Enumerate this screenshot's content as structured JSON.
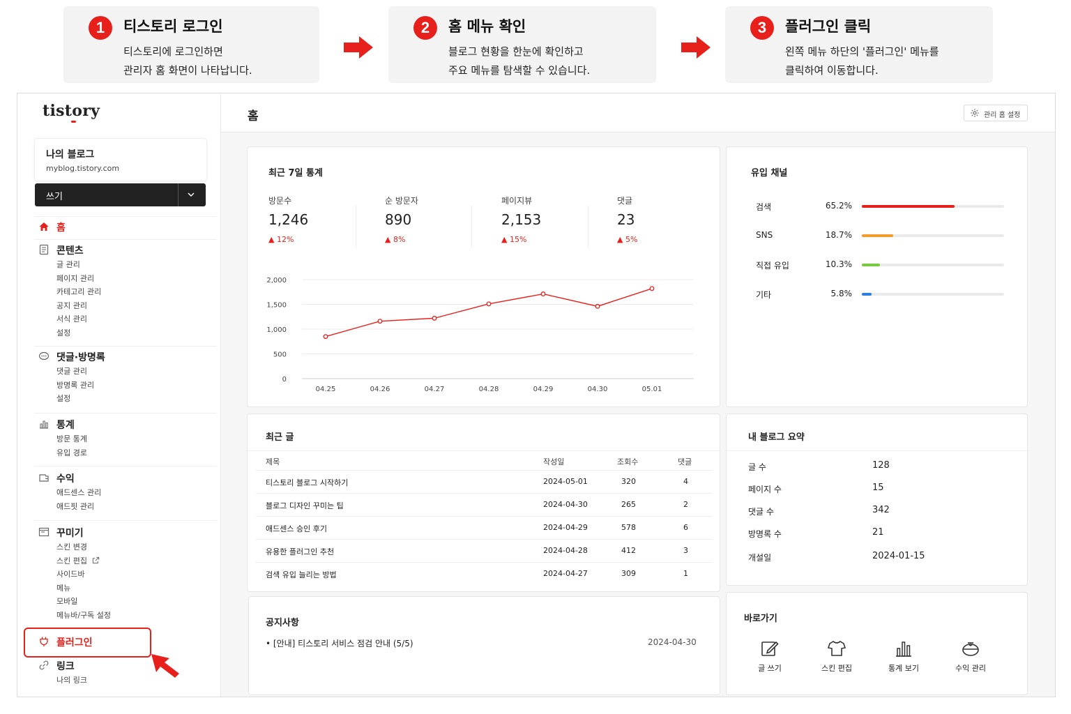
{
  "steps": [
    {
      "number": "1",
      "title": "티스토리 로그인",
      "desc1": "티스토리에 로그인하면",
      "desc2": "관리자 홈 화면이 나타납니다."
    },
    {
      "number": "2",
      "title": "홈 메뉴 확인",
      "desc1": "블로그 현황을 한눈에 확인하고",
      "desc2": "주요 메뉴를 탐색할 수 있습니다."
    },
    {
      "number": "3",
      "title": "플러그인 클릭",
      "desc1": "왼쪽 메뉴 하단의 '플러그인' 메뉴를",
      "desc2": "클릭하여 이동합니다."
    }
  ],
  "brand": "tistory",
  "blog": {
    "name": "나의 블로그",
    "url": "myblog.tistory.com"
  },
  "write_label": "쓰기",
  "nav": {
    "home": "홈",
    "content": {
      "label": "콘텐츠",
      "items": [
        "글 관리",
        "페이지 관리",
        "카테고리 관리",
        "공지 관리",
        "서식 관리",
        "설정"
      ]
    },
    "comments": {
      "label": "댓글·방명록",
      "items": [
        "댓글 관리",
        "방명록 관리",
        "설정"
      ]
    },
    "stats": {
      "label": "통계",
      "items": [
        "방문 통계",
        "유입 경로"
      ]
    },
    "revenue": {
      "label": "수익",
      "items": [
        "애드센스 관리",
        "애드핏 관리"
      ]
    },
    "decorate": {
      "label": "꾸미기",
      "items": [
        "스킨 변경",
        "스킨 편집",
        "사이드바",
        "메뉴",
        "모바일",
        "메뉴바/구독 설정"
      ]
    },
    "plugin": "플러그인",
    "link": {
      "label": "링크",
      "items": [
        "나의 링크"
      ]
    }
  },
  "page_title": "홈",
  "admin_setting": "관리 홈 설정",
  "weekly": {
    "title": "최근 7일 통계",
    "stats": [
      {
        "label": "방문수",
        "value": "1,246",
        "delta": "12%"
      },
      {
        "label": "순 방문자",
        "value": "890",
        "delta": "8%"
      },
      {
        "label": "페이지뷰",
        "value": "2,153",
        "delta": "15%"
      },
      {
        "label": "댓글",
        "value": "23",
        "delta": "5%"
      }
    ]
  },
  "chart_data": {
    "type": "line",
    "title": "",
    "xlabel": "",
    "ylabel": "",
    "x": [
      "04.25",
      "04.26",
      "04.27",
      "04.28",
      "04.29",
      "04.30",
      "05.01"
    ],
    "y_ticks": [
      "2,000",
      "1,500",
      "1,000",
      "500",
      "0"
    ],
    "ylim": [
      0,
      2000
    ],
    "grid": true,
    "series": [
      {
        "values": [
          850,
          1160,
          1220,
          1510,
          1710,
          1460,
          1820
        ]
      }
    ],
    "line_color": "#e8201c"
  },
  "channels": {
    "title": "유입 채널",
    "items": [
      {
        "name": "검색",
        "pct_label": "65.2%",
        "pct": 0.652,
        "color": "#e8201c"
      },
      {
        "name": "SNS",
        "pct_label": "18.7%",
        "pct": 0.223,
        "color": "#f39c2b"
      },
      {
        "name": "직접 유입",
        "pct_label": "10.3%",
        "pct": 0.125,
        "color": "#7ac943"
      },
      {
        "name": "기타",
        "pct_label": "5.8%",
        "pct": 0.07,
        "color": "#2f7de1"
      }
    ]
  },
  "recent_posts": {
    "title": "최근 글",
    "headers": [
      "제목",
      "작성일",
      "조회수",
      "댓글"
    ],
    "rows": [
      [
        "티스토리 블로그 시작하기",
        "2024-05-01",
        "320",
        "4"
      ],
      [
        "블로그 디자인 꾸미는 팁",
        "2024-04-30",
        "265",
        "2"
      ],
      [
        "애드센스 승인 후기",
        "2024-04-29",
        "578",
        "6"
      ],
      [
        "유용한 플러그인 추천",
        "2024-04-28",
        "412",
        "3"
      ],
      [
        "검색 유입 늘리는 방법",
        "2024-04-27",
        "309",
        "1"
      ]
    ]
  },
  "summary": {
    "title": "내 블로그 요약",
    "items": [
      {
        "label": "글 수",
        "value": "128"
      },
      {
        "label": "페이지 수",
        "value": "15"
      },
      {
        "label": "댓글 수",
        "value": "342"
      },
      {
        "label": "방명록 수",
        "value": "21"
      },
      {
        "label": "개설일",
        "value": "2024-01-15"
      }
    ]
  },
  "notice": {
    "title": "공지사항",
    "item": "• [안내] 티스토리 서비스 점검 안내 (5/5)",
    "date": "2024-04-30"
  },
  "shortcuts": {
    "title": "바로가기",
    "items": [
      {
        "label": "글 쓰기",
        "icon": "pencil-icon"
      },
      {
        "label": "스킨 편집",
        "icon": "tshirt-icon"
      },
      {
        "label": "통계 보기",
        "icon": "bar-chart-icon"
      },
      {
        "label": "수익 관리",
        "icon": "coin-pot-icon"
      }
    ]
  },
  "colors": {
    "accent": "#e8201c",
    "sidebar_bg": "#ffffff",
    "main_bg": "#f6f6f6"
  }
}
